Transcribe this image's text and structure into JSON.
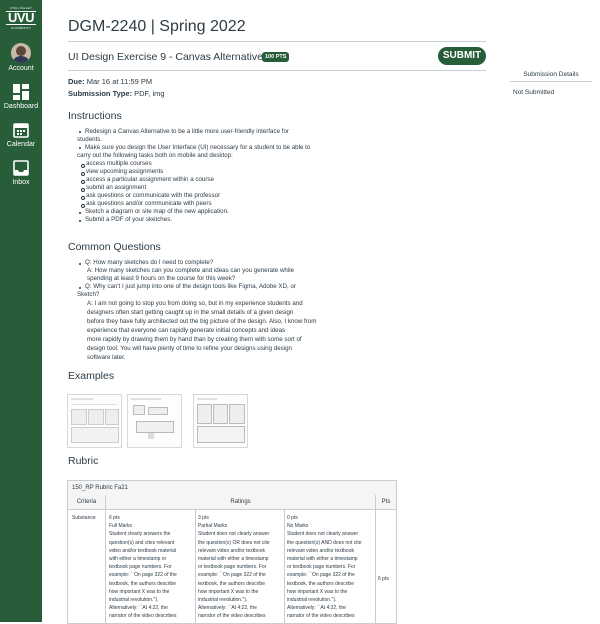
{
  "sidebar": {
    "logo_top": "UTAH VALLEY",
    "logo_main": "UVU",
    "logo_bottom": "UNIVERSITY",
    "items": [
      {
        "label": "Account"
      },
      {
        "label": "Dashboard"
      },
      {
        "label": "Calendar"
      },
      {
        "label": "Inbox"
      }
    ]
  },
  "course_title": "DGM-2240 | Spring 2022",
  "assignment": {
    "title": "UI Design Exercise 9 - Canvas Alternative",
    "points_badge": "100 PTS",
    "submit_label": "SUBMIT",
    "due_label": "Due:",
    "due_value": "Mar 16 at 11:59 PM",
    "type_label": "Submission Type:",
    "type_value": "PDF, img"
  },
  "submission_panel": {
    "title": "Submission Details",
    "status": "Not Submitted"
  },
  "instructions": {
    "heading": "Instructions",
    "lines": [
      "Redesign a Canvas Alternative to be a little more user-friendly interface for",
      "students.",
      "Make sure you design the User Interface (UI) necessary for a student to be able to",
      "carry out the following tasks both on mobile and desktop:",
      "access multiple courses",
      "view upcoming assignments",
      "access a particular assignment within a course",
      "submit an assignment",
      "ask questions or communicate with the professor",
      "ask questions and/or communicate with peers",
      "Sketch a diagram or site map of the new application.",
      "Submit a PDF of your sketches."
    ]
  },
  "questions": {
    "heading": "Common Questions",
    "lines": [
      "Q: How many sketches do I need to complete?",
      "A: How many sketches can you complete and ideas can you generate while",
      "spending at least 9 hours on the course for this week?",
      "Q: Why can't I just jump into one of the design tools like Figma, Adobe XD, or",
      "Sketch?",
      "A: I am not going to stop you from doing so, but in my experience students and",
      "designers often start getting caught up in the small details of a given design",
      "before they have fully architected out the big picture of the design. Also, I know from",
      "experience that everyone can rapidly generate initial concepts and ideas",
      "more rapidly by drawing them by hand than by creating them with some sort of",
      "design tool. You will have plenty of time to refine your designs using design",
      "software later."
    ]
  },
  "examples": {
    "heading": "Examples"
  },
  "rubric": {
    "heading": "Rubric",
    "name": "150_RP Rubric Fa21",
    "col_criteria": "Criteria",
    "col_ratings": "Ratings",
    "col_pts": "Pts",
    "criterion": "Substance",
    "total_pts": "6 pts",
    "ratings": [
      {
        "pts": "6 pts",
        "title": "Full Marks",
        "lines": [
          "Student clearly answers the",
          "question(s) and cites relevant",
          "video and/or textbook material",
          "with either a timestamp or",
          "textbook page numbers. For",
          "example: ``On page 322 of the",
          "textbook, the authors describe",
          "how important X was to the",
          "industrial revolution.'').",
          "Alternatively: ``At 4:22, the",
          "narrator of the video describes"
        ]
      },
      {
        "pts": "3 pts",
        "title": "Partial Marks",
        "lines": [
          "Student does not clearly answer",
          "the question(s) OR does not cite",
          "relevant video and/or textbook",
          "material with either a timestamp",
          "or textbook page numbers. For",
          "example: ``On page 322 of the",
          "textbook, the authors describe",
          "how important X was to the",
          "industrial revolution.'').",
          "Alternatively: ``At 4:22, the",
          "narrator of the video describes"
        ]
      },
      {
        "pts": "0 pts",
        "title": "No Marks",
        "lines": [
          "Student does not clearly answer",
          "the question(s) AND does not cite",
          "relevant video and/or textbook",
          "material with either a timestamp",
          "or textbook page numbers. For",
          "example: ``On page 322 of the",
          "textbook, the authors describe",
          "how important X was to the",
          "industrial revolution.'').",
          "Alternatively: ``At 4:22, the",
          "narrator of the video describes"
        ]
      }
    ]
  },
  "colors": {
    "brand_green": "#275d38",
    "text": "#2d3b45",
    "border": "#c7cdd1"
  }
}
